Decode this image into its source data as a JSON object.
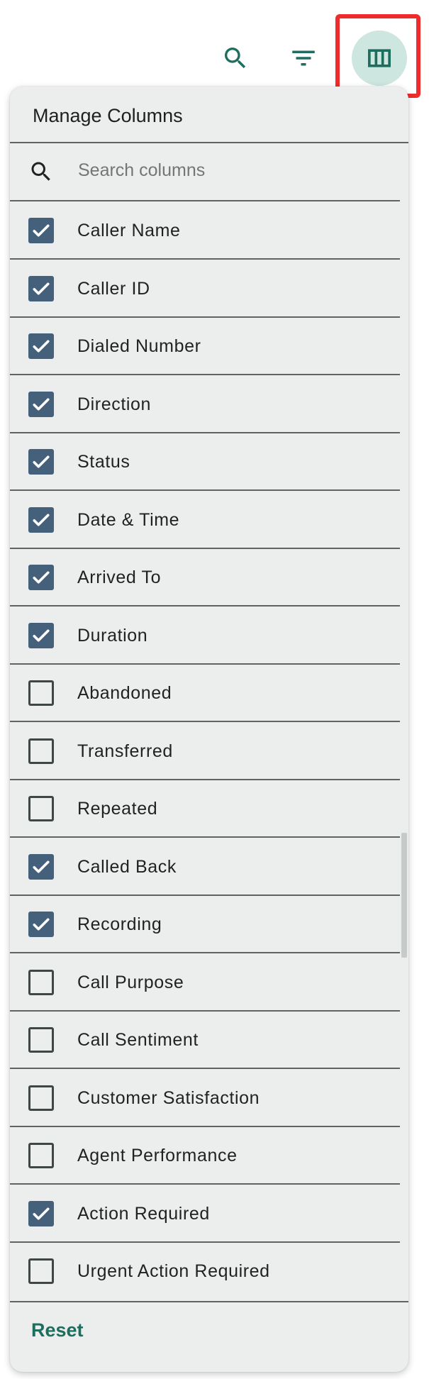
{
  "toolbar": {
    "search_icon": "search-icon",
    "filter_icon": "filter-icon",
    "columns_icon": "view-columns-icon",
    "accent_color": "#1d6e5f",
    "highlight_color": "#ef2b2b"
  },
  "panel": {
    "title": "Manage Columns",
    "search_placeholder": "Search columns",
    "reset_label": "Reset",
    "checked_color": "#45607a"
  },
  "columns": [
    {
      "label": "Caller Name",
      "checked": true
    },
    {
      "label": "Caller ID",
      "checked": true
    },
    {
      "label": "Dialed Number",
      "checked": true
    },
    {
      "label": "Direction",
      "checked": true
    },
    {
      "label": "Status",
      "checked": true
    },
    {
      "label": "Date & Time",
      "checked": true
    },
    {
      "label": "Arrived To",
      "checked": true
    },
    {
      "label": "Duration",
      "checked": true
    },
    {
      "label": "Abandoned",
      "checked": false
    },
    {
      "label": "Transferred",
      "checked": false
    },
    {
      "label": "Repeated",
      "checked": false
    },
    {
      "label": "Called Back",
      "checked": true
    },
    {
      "label": "Recording",
      "checked": true
    },
    {
      "label": "Call Purpose",
      "checked": false
    },
    {
      "label": "Call Sentiment",
      "checked": false
    },
    {
      "label": "Customer Satisfaction",
      "checked": false
    },
    {
      "label": "Agent Performance",
      "checked": false
    },
    {
      "label": "Action Required",
      "checked": true
    },
    {
      "label": "Urgent Action Required",
      "checked": false
    }
  ]
}
